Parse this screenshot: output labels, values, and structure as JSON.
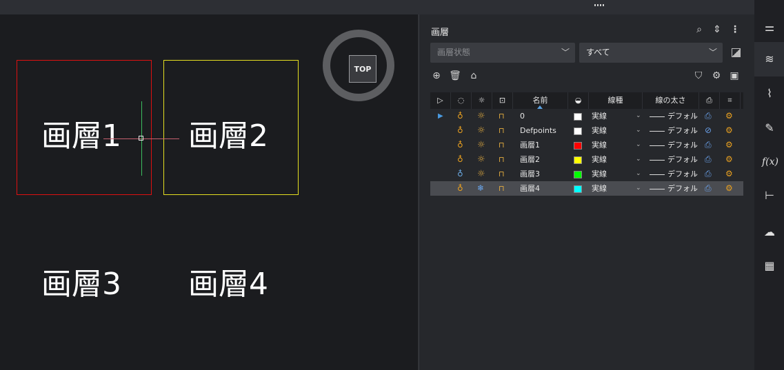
{
  "canvas": {
    "labels": [
      "画層1",
      "画層2",
      "画層3",
      "画層4"
    ],
    "viewcube_label": "TOP"
  },
  "panel": {
    "title": "画層",
    "state_dropdown_placeholder": "画層状態",
    "filter_dropdown_value": "すべて",
    "columns": [
      "名前",
      "線種",
      "線の太さ"
    ],
    "rows": [
      {
        "name": "0",
        "color": "#ffffff",
        "linetype": "実線",
        "lineweight": "デフォル",
        "current": true,
        "bulb": "on",
        "freeze": "sun",
        "plot_blocked": false
      },
      {
        "name": "Defpoints",
        "color": "#ffffff",
        "linetype": "実線",
        "lineweight": "デフォル",
        "current": false,
        "bulb": "on",
        "freeze": "sun",
        "plot_blocked": true
      },
      {
        "name": "画層1",
        "color": "#ff0000",
        "linetype": "実線",
        "lineweight": "デフォル",
        "current": false,
        "bulb": "on",
        "freeze": "sun",
        "plot_blocked": false
      },
      {
        "name": "画層2",
        "color": "#ffff00",
        "linetype": "実線",
        "lineweight": "デフォル",
        "current": false,
        "bulb": "on",
        "freeze": "sun",
        "plot_blocked": false
      },
      {
        "name": "画層3",
        "color": "#00ff00",
        "linetype": "実線",
        "lineweight": "デフォル",
        "current": false,
        "bulb": "off",
        "freeze": "sun",
        "plot_blocked": false
      },
      {
        "name": "画層4",
        "color": "#00ffff",
        "linetype": "実線",
        "lineweight": "デフォル",
        "current": false,
        "bulb": "on",
        "freeze": "snow",
        "plot_blocked": false,
        "selected": true
      }
    ]
  },
  "rightbar": {
    "icons": [
      "properties-icon",
      "layers-icon",
      "attachments-icon",
      "drawing-explorer-icon",
      "formula-icon",
      "structure-icon",
      "cloud-icon",
      "grid-icon"
    ]
  }
}
